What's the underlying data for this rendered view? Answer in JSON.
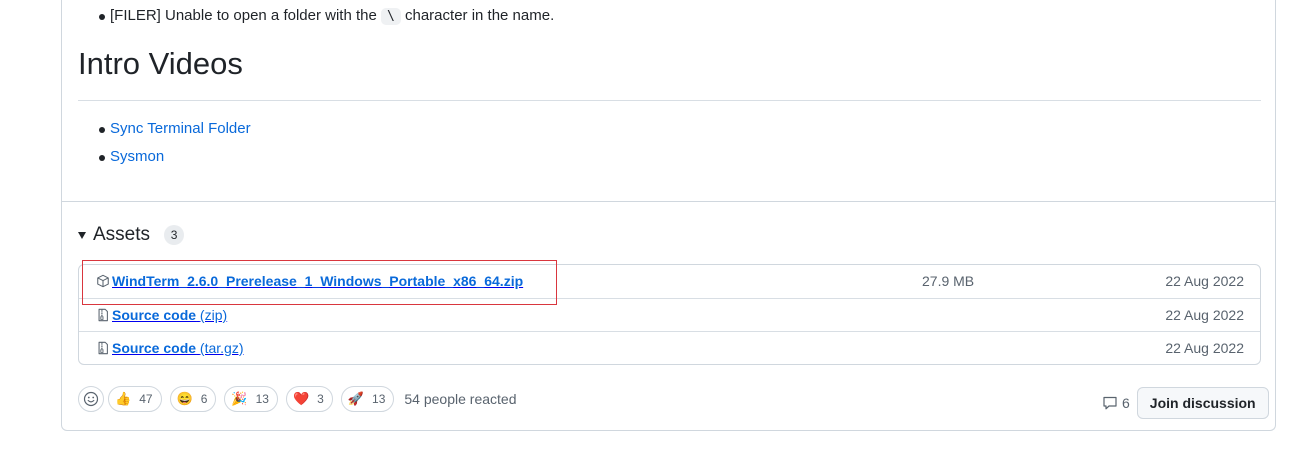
{
  "release_notes": {
    "filer_item": {
      "prefix": "[FILER] Unable to open a folder with the",
      "code": "\\",
      "suffix": "character in the name."
    },
    "intro_videos": {
      "heading": "Intro Videos",
      "links": [
        "Sync Terminal Folder",
        "Sysmon"
      ]
    }
  },
  "assets": {
    "title": "Assets",
    "count": "3",
    "rows": [
      {
        "icon": "package-icon",
        "name": "WindTerm_2.6.0_Prerelease_1_Windows_Portable_x86_64.zip",
        "ext": "",
        "size": "27.9 MB",
        "date": "22 Aug 2022"
      },
      {
        "icon": "file-zip-icon",
        "name": "Source code",
        "ext": "(zip)",
        "size": "",
        "date": "22 Aug 2022"
      },
      {
        "icon": "file-zip-icon",
        "name": "Source code",
        "ext": "(tar.gz)",
        "size": "",
        "date": "22 Aug 2022"
      }
    ]
  },
  "reactions": {
    "items": [
      {
        "emoji": "👍",
        "count": "47"
      },
      {
        "emoji": "😄",
        "count": "6"
      },
      {
        "emoji": "🎉",
        "count": "13"
      },
      {
        "emoji": "❤️",
        "count": "3"
      },
      {
        "emoji": "🚀",
        "count": "13"
      }
    ],
    "summary": "54 people reacted"
  },
  "discussion": {
    "comment_count": "6",
    "join_label": "Join discussion"
  },
  "colors": {
    "link": "#0969da",
    "highlight": "#d9363e",
    "border": "#d0d7de"
  }
}
